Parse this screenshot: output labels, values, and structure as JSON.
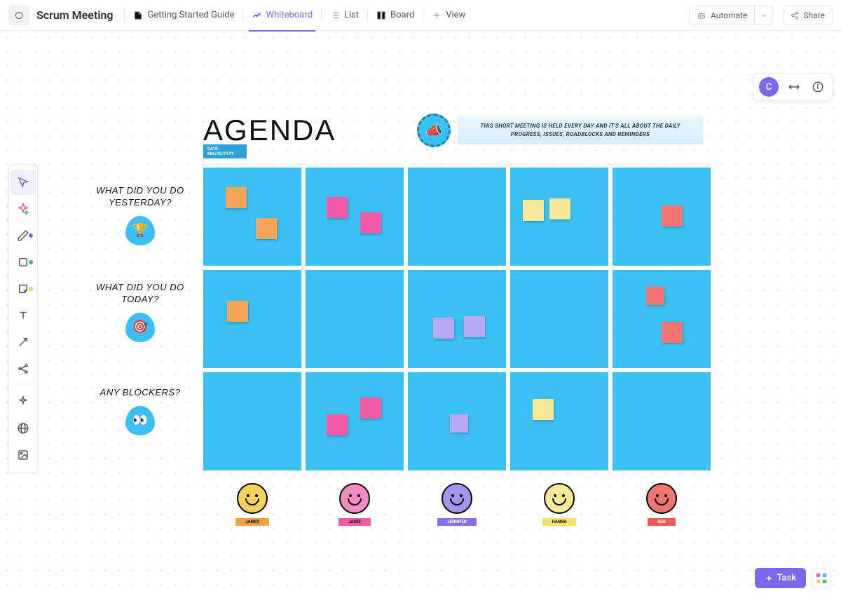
{
  "header": {
    "title": "Scrum Meeting",
    "tabs": {
      "guide": "Getting Started Guide",
      "whiteboard": "Whiteboard",
      "list": "List",
      "board": "Board",
      "view": "View"
    },
    "automate": "Automate",
    "share": "Share"
  },
  "float": {
    "avatar": "C"
  },
  "board": {
    "agenda": "AGENDA",
    "date": "DATE: MM/DD/YYYY",
    "desc": "This short meeting is held every day and it's all about the daily progress, issues, roadblocks and reminders",
    "row1": "What did you do yesterday?",
    "row2": "What did you do today?",
    "row3": "Any blockers?"
  },
  "people": [
    {
      "name": "JAMES",
      "face": "#f7d358",
      "tag": "#f2a04a"
    },
    {
      "name": "JAMIE",
      "face": "#f25aa8",
      "tag": "#f25aa8"
    },
    {
      "name": "JENNIFER",
      "face": "#8a6de8",
      "tag": "#8a6de8"
    },
    {
      "name": "HANNA",
      "face": "#f8e99a",
      "tag": "#f2e06a"
    },
    {
      "name": "BEN",
      "face": "#e85a52",
      "tag": "#e85a52"
    }
  ],
  "task_btn": "Task"
}
